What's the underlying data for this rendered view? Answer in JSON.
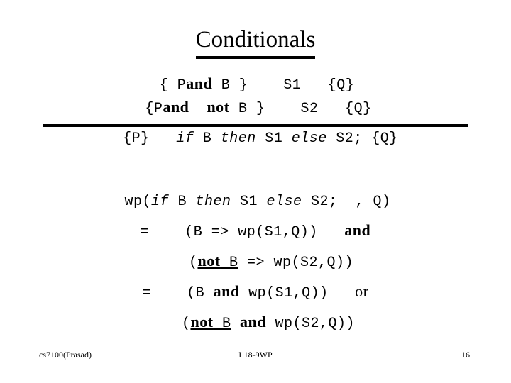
{
  "slide": {
    "title": "Conditionals",
    "background_color": "#ffffff",
    "text_color": "#000000"
  },
  "rule": {
    "premise_1": {
      "open_brace": "{ ",
      "p": "P",
      "and": "and",
      "b": " B }",
      "gap_1": "    ",
      "stmt": "S1",
      "gap_2": "   ",
      "post": "{Q}"
    },
    "premise_2": {
      "open_brace": "{",
      "p": "P",
      "and": "and",
      "not": "not",
      "b": " B }",
      "gap_1": "    ",
      "stmt": "S2",
      "gap_2": "   ",
      "post": "{Q}"
    },
    "conclusion": {
      "pre": "{P}",
      "gap": "   ",
      "if": "if",
      "cond": " B ",
      "then": "then",
      "stmt_1": " S1 ",
      "else": "else",
      "stmt_2": " S2; ",
      "post": "{Q}"
    }
  },
  "wp": {
    "line_1": {
      "head": "wp(",
      "if": "if",
      "cond": " B ",
      "then": "then",
      "stmt_1": " S1 ",
      "else": "else",
      "stmt_2": " S2; ",
      "tail": " , Q)"
    },
    "line_2": {
      "eq": "=",
      "gap": "    ",
      "expr_open": "(B => wp(S1,Q))",
      "gap_2": "   ",
      "and": "and"
    },
    "line_3": {
      "open_paren": "(",
      "not": "not",
      "cond": " B",
      "rest": " => wp(S2,Q))"
    },
    "line_4": {
      "eq": "=",
      "gap": "    ",
      "expr_open": "(B ",
      "and": "and",
      "expr_rest": " wp(S1,Q))",
      "gap_2": "   ",
      "or": "or"
    },
    "line_5": {
      "open_paren": "(",
      "not": "not",
      "cond": " B",
      "gap": " ",
      "and": "and",
      "rest": " wp(S2,Q))"
    }
  },
  "footer": {
    "left": "cs7100(Prasad)",
    "center": "L18-9WP",
    "page_number": "16"
  }
}
